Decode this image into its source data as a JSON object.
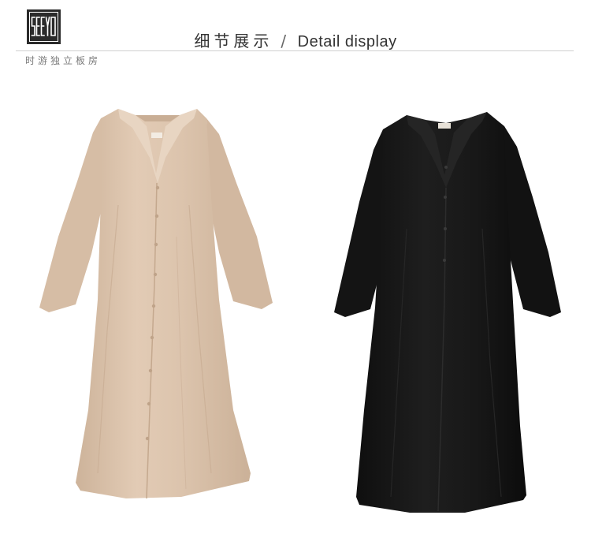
{
  "brand": {
    "logo_text": "SEEYO",
    "tagline": "时游独立板房"
  },
  "header": {
    "title_cn": "细节展示",
    "separator": "/",
    "title_en": "Detail display"
  },
  "products": [
    {
      "color_name": "beige",
      "fill": "#dcc4ad"
    },
    {
      "color_name": "black",
      "fill": "#161616"
    }
  ]
}
